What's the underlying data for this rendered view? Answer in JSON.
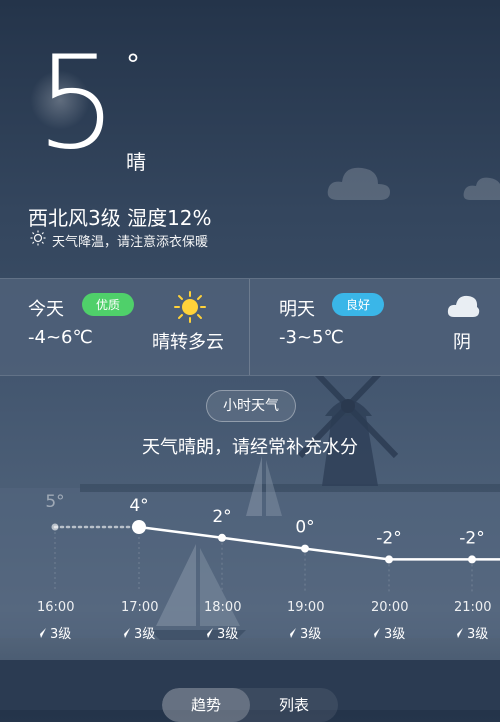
{
  "current": {
    "temperature": "5",
    "degree_symbol": "°",
    "condition": "晴",
    "wind_humidity": "西北风3级  湿度12%",
    "tip": "天气降温，请注意添衣保暖"
  },
  "forecast": {
    "today": {
      "label": "今天",
      "badge": "优质",
      "badge_color": "#4fd06a",
      "range": "-4~6℃",
      "condition": "晴转多云",
      "icon": "sun-icon"
    },
    "tomorrow": {
      "label": "明天",
      "badge": "良好",
      "badge_color": "#3ab6e8",
      "range": "-3~5℃",
      "condition": "阴",
      "icon": "cloud-icon"
    }
  },
  "hourly": {
    "button_label": "小时天气",
    "message": "天气晴朗，请经常补充水分",
    "hours": [
      {
        "time": "16:00",
        "temp": "5°",
        "wind": "3级"
      },
      {
        "time": "17:00",
        "temp": "4°",
        "wind": "3级"
      },
      {
        "time": "18:00",
        "temp": "2°",
        "wind": "3级"
      },
      {
        "time": "19:00",
        "temp": "0°",
        "wind": "3级"
      },
      {
        "time": "20:00",
        "temp": "-2°",
        "wind": "3级"
      },
      {
        "time": "21:00",
        "temp": "-2°",
        "wind": "3级"
      }
    ]
  },
  "toggle": {
    "trend": "趋势",
    "list": "列表"
  },
  "colors": {
    "line": "#ffffff",
    "badge_good": "#4fd06a",
    "badge_ok": "#3ab6e8"
  }
}
